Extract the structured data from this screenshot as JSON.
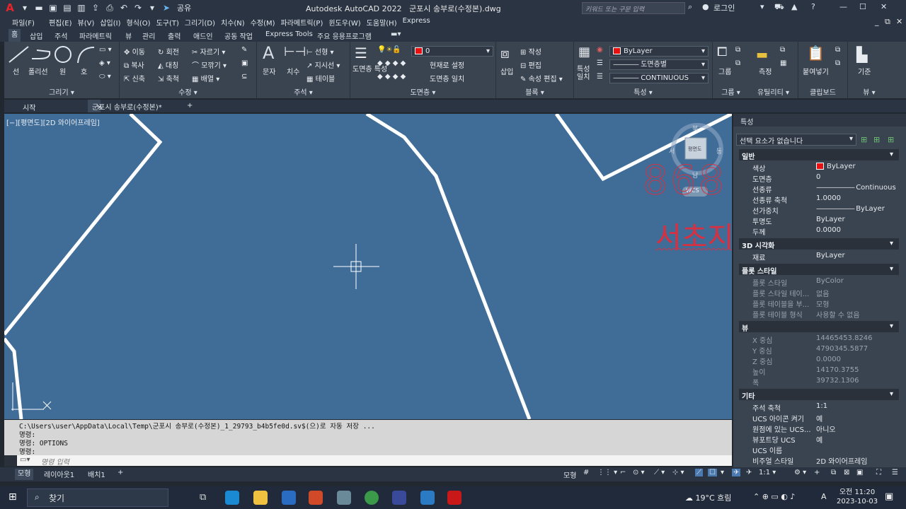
{
  "title": {
    "app": "Autodesk AutoCAD 2022",
    "file": "군포시 송부로(수정본).dwg",
    "share": "공유",
    "search_placeholder": "키워드 또는 구문 입력",
    "login": "로그인"
  },
  "menu": [
    "파일(F)",
    "편집(E)",
    "뷰(V)",
    "삽입(I)",
    "형식(O)",
    "도구(T)",
    "그리기(D)",
    "치수(N)",
    "수정(M)",
    "파라메트릭(P)",
    "윈도우(W)",
    "도움말(H)",
    "Express"
  ],
  "ribbon_tabs": [
    "홈",
    "삽입",
    "주석",
    "파라메트릭",
    "뷰",
    "관리",
    "출력",
    "애드인",
    "공동 작업",
    "Express Tools",
    "주요 응용프로그램"
  ],
  "ribbon": {
    "draw": {
      "label": "그리기",
      "line": "선",
      "polyline": "폴리선",
      "circle": "원",
      "arc": "호"
    },
    "modify": {
      "label": "수정",
      "move": "이동",
      "rotate": "회전",
      "trim": "자르기",
      "copy": "복사",
      "mirror": "대칭",
      "fillet": "모깎기",
      "stretch": "신축",
      "scale": "축척",
      "array": "배열"
    },
    "annotation": {
      "label": "주석",
      "text": "문자",
      "dimension": "치수",
      "linear": "선형",
      "leader": "지시선",
      "table": "테이블"
    },
    "layers": {
      "label": "도면층",
      "props": "도면층 특성",
      "current_layer": "0",
      "make_current": "현재로 설정",
      "match_layer": "도면층 일치"
    },
    "block": {
      "label": "블록",
      "insert": "삽입",
      "create": "작성",
      "edit": "편집",
      "attr_edit": "속성 편집"
    },
    "properties": {
      "label": "특성",
      "match": "특성 일치",
      "color": "ByLayer",
      "lineweight": "도면층별",
      "linetype": "CONTINUOUS"
    },
    "groups": {
      "label": "그룹",
      "group": "그룹"
    },
    "utilities": {
      "label": "유틸리티",
      "measure": "측정"
    },
    "clipboard": {
      "label": "클립보드",
      "paste": "붙여넣기"
    },
    "view": {
      "label": "뷰",
      "base": "기준"
    }
  },
  "doc_tabs": {
    "start": "시작",
    "current": "군포시 송부로(수정본)*"
  },
  "viewport": {
    "label": "[−][평면도][2D 와이어프레임]",
    "viewcube": {
      "top": "북",
      "left": "서",
      "right": "동",
      "bottom": "남",
      "face": "평면도",
      "wcs": "WCS"
    },
    "drawing_text_1": "868",
    "drawing_text_2": "서초지"
  },
  "properties_palette": {
    "title": "특성",
    "selection": "선택 요소가 없습니다",
    "sections": [
      {
        "name": "일반",
        "rows": [
          {
            "key": "색상",
            "value": "ByLayer"
          },
          {
            "key": "도면층",
            "value": "0"
          },
          {
            "key": "선종류",
            "value": "Continuous"
          },
          {
            "key": "선종류 축척",
            "value": "1.0000"
          },
          {
            "key": "선가중치",
            "value": "ByLayer"
          },
          {
            "key": "투명도",
            "value": "ByLayer"
          },
          {
            "key": "두께",
            "value": "0.0000"
          }
        ]
      },
      {
        "name": "3D 시각화",
        "rows": [
          {
            "key": "재료",
            "value": "ByLayer"
          }
        ]
      },
      {
        "name": "플롯 스타일",
        "rows": [
          {
            "key": "플롯 스타일",
            "value": "ByColor"
          },
          {
            "key": "플롯 스타일 테이...",
            "value": "없음"
          },
          {
            "key": "플롯 테이블을 부...",
            "value": "모형"
          },
          {
            "key": "플롯 테이블 형식",
            "value": "사용할 수 없음"
          }
        ]
      },
      {
        "name": "뷰",
        "rows": [
          {
            "key": "X 중심",
            "value": "14465453.8246"
          },
          {
            "key": "Y 중심",
            "value": "4790345.5877"
          },
          {
            "key": "Z 중심",
            "value": "0.0000"
          },
          {
            "key": "높이",
            "value": "14170.3755"
          },
          {
            "key": "폭",
            "value": "39732.1306"
          }
        ]
      },
      {
        "name": "기타",
        "rows": [
          {
            "key": "주석 축척",
            "value": "1:1"
          },
          {
            "key": "UCS 아이콘 켜기",
            "value": "예"
          },
          {
            "key": "원점에 있는 UCS...",
            "value": "아니오"
          },
          {
            "key": "뷰포트당 UCS",
            "value": "예"
          },
          {
            "key": "UCS 이름",
            "value": ""
          },
          {
            "key": "비주얼 스타일",
            "value": "2D 와이어프레임"
          }
        ]
      }
    ]
  },
  "command": {
    "history": [
      "C:\\Users\\user\\AppData\\Local\\Temp\\군포시 송부로(수정본)_1_29793_b4b5fe0d.sv$(으)로 자동 저장 ...",
      "명령:",
      "명령:  OPTIONS",
      "명령:"
    ],
    "placeholder": "명령 입력"
  },
  "layout_tabs": [
    "모형",
    "레이아웃1",
    "배치1"
  ],
  "status": {
    "model": "모형",
    "scale": "1:1"
  },
  "taskbar": {
    "search": "찾기",
    "weather": "19°C 흐림",
    "time": "오전 11:20",
    "date": "2023-10-03",
    "lang": "A"
  }
}
